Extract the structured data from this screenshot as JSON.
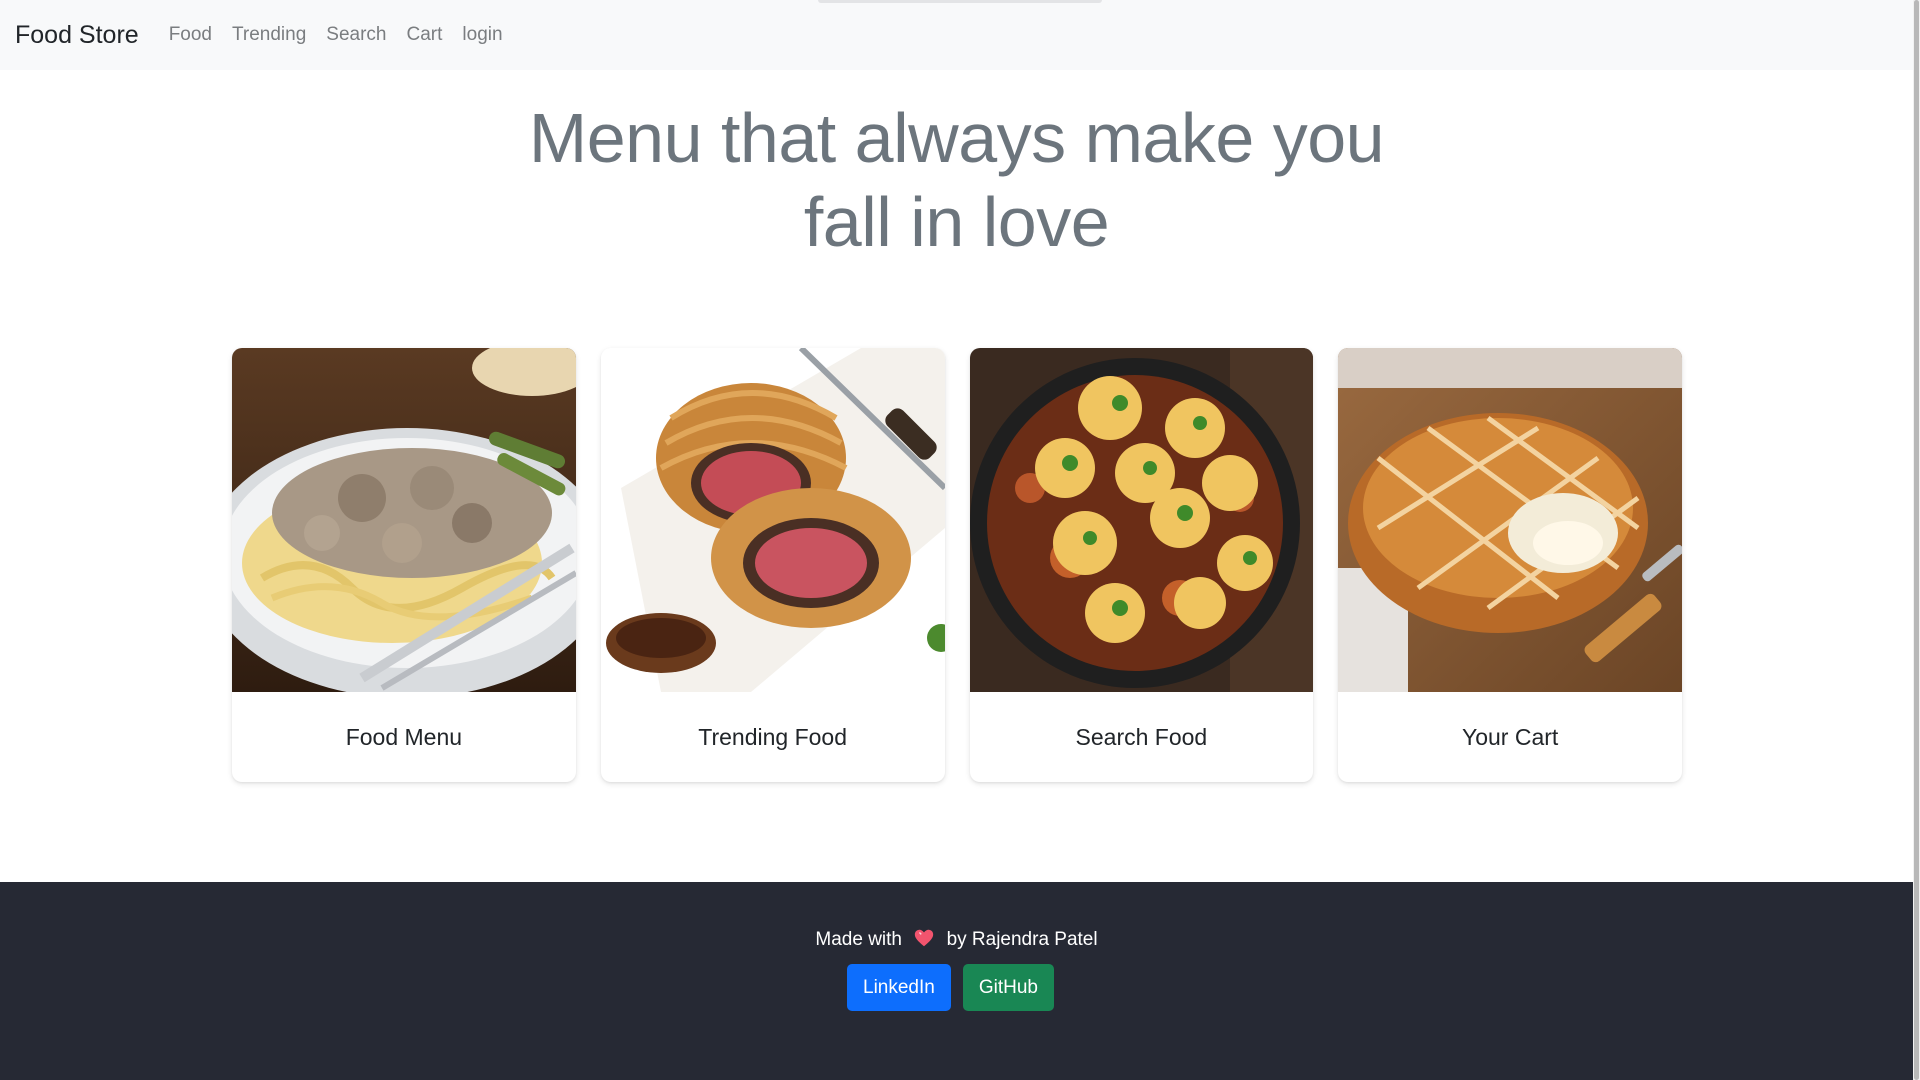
{
  "navbar": {
    "brand": "Food Store",
    "links": [
      "Food",
      "Trending",
      "Search",
      "Cart",
      "login"
    ]
  },
  "hero": {
    "line1": "Menu that always make you",
    "line2": "fall in love"
  },
  "cards": [
    {
      "title": "Food Menu",
      "image": "pasta-stroganoff-image"
    },
    {
      "title": "Trending Food",
      "image": "beef-wellington-image"
    },
    {
      "title": "Search Food",
      "image": "stew-dumplings-image"
    },
    {
      "title": "Your Cart",
      "image": "baked-brie-pie-image"
    }
  ],
  "footer": {
    "made_with": "Made with",
    "by": "by Rajendra Patel",
    "heart_icon": "heart-icon",
    "buttons": {
      "linkedin": "LinkedIn",
      "github": "GitHub"
    }
  },
  "colors": {
    "navbar_bg": "#f8f9fa",
    "footer_bg": "#262934",
    "linkedin": "#0d6efd",
    "github": "#198754"
  }
}
